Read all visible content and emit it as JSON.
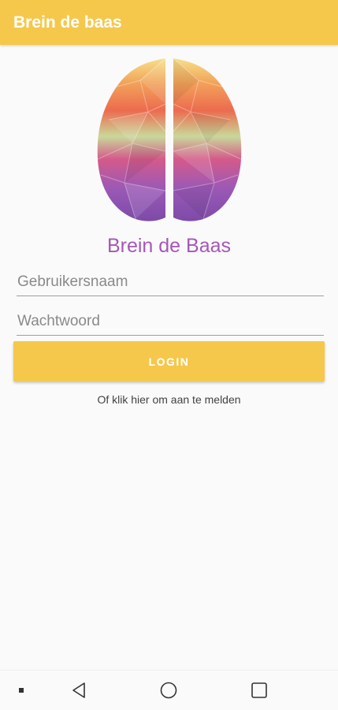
{
  "appbar": {
    "title": "Brein de baas",
    "color": "#f5c84c"
  },
  "brand": {
    "name": "Brein de Baas",
    "color": "#a557b8"
  },
  "form": {
    "username_placeholder": "Gebruikersnaam",
    "username_value": "",
    "password_placeholder": "Wachtwoord",
    "password_value": "",
    "login_label": "LOGIN",
    "register_text": "Of klik hier om aan te melden"
  },
  "navbar": {
    "icons": [
      "recents-dot-icon",
      "back-icon",
      "home-icon",
      "overview-icon"
    ]
  }
}
